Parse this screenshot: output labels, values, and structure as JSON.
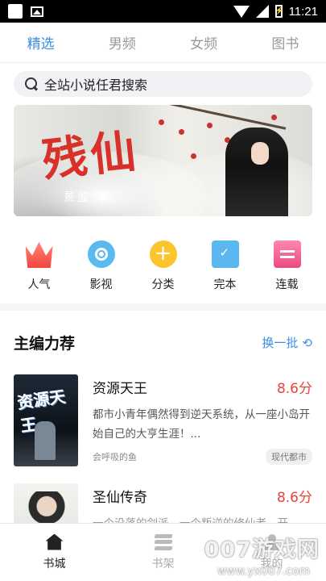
{
  "status_bar": {
    "time": "11:21"
  },
  "tabs": [
    {
      "label": "精选",
      "active": true
    },
    {
      "label": "男频",
      "active": false
    },
    {
      "label": "女频",
      "active": false
    },
    {
      "label": "图书",
      "active": false
    }
  ],
  "search": {
    "placeholder": "全站小说任君搜索"
  },
  "banner": {
    "title": "残仙",
    "author": "景监 著"
  },
  "quick_entries": [
    {
      "label": "人气",
      "icon": "popularity-icon"
    },
    {
      "label": "影视",
      "icon": "film-icon"
    },
    {
      "label": "分类",
      "icon": "category-icon"
    },
    {
      "label": "完本",
      "icon": "completed-icon"
    },
    {
      "label": "连载",
      "icon": "serial-icon"
    }
  ],
  "section": {
    "title": "主编力荐",
    "refresh_label": "换一批"
  },
  "books": [
    {
      "title": "资源天王",
      "score": "8.6分",
      "cover_text": "资源天王",
      "description": "都市小青年偶然得到逆天系统，从一座小岛开始自己的大亨生涯！...",
      "author": "会呼吸的鱼",
      "tag": "现代都市"
    },
    {
      "title": "圣仙传奇",
      "score": "8.6分",
      "description": "一个没落的剑派，一个叛逆的修仙者，开"
    }
  ],
  "bottom_nav": [
    {
      "label": "书城",
      "active": true
    },
    {
      "label": "书架",
      "active": false
    },
    {
      "label": "我的",
      "active": false
    }
  ],
  "watermark": {
    "main": "007游戏网",
    "sub": "www.yx007.com"
  },
  "colors": {
    "accent": "#3a8ee6",
    "score": "#e8443a"
  }
}
